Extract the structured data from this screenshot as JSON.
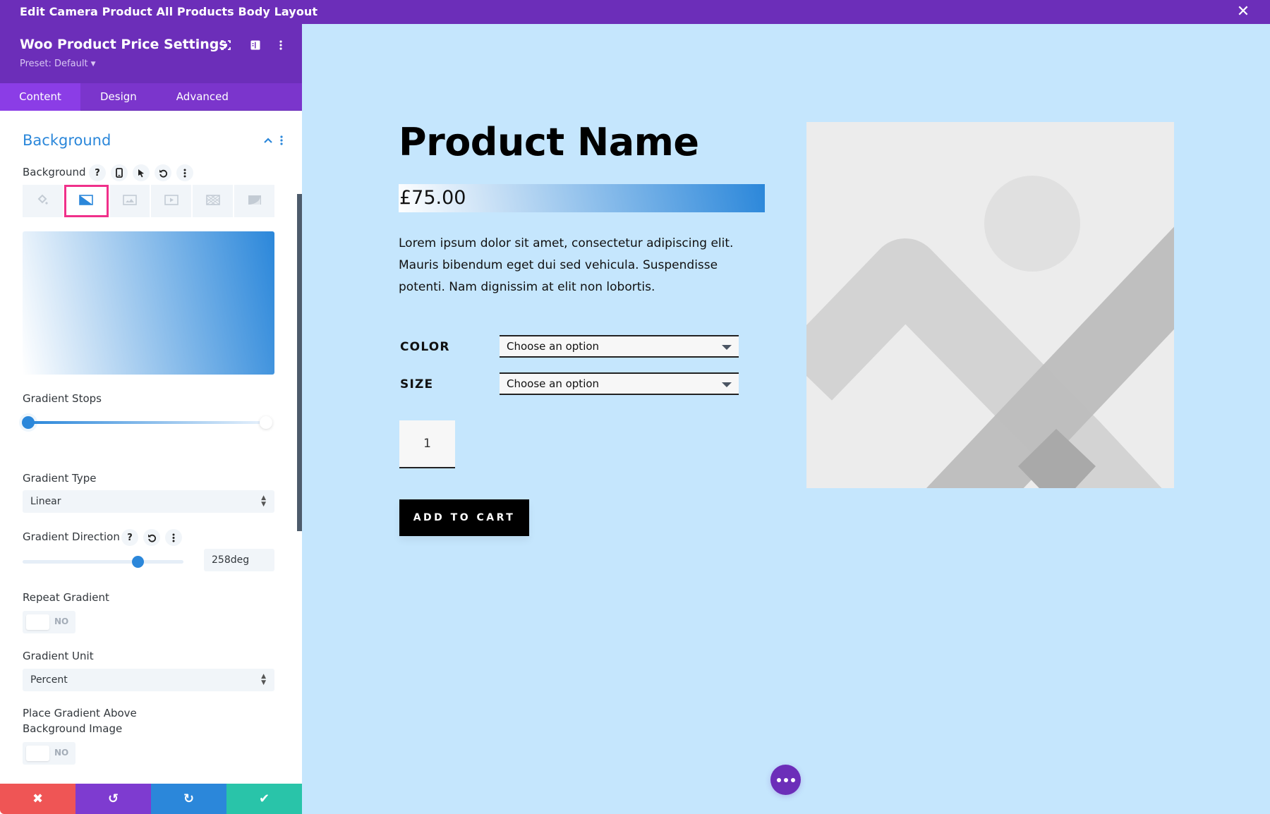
{
  "window": {
    "title": "Edit Camera Product All Products Body Layout",
    "close_icon": "close-icon"
  },
  "panel": {
    "title": "Woo Product Price Settings",
    "preset": "Preset: Default",
    "header_icons": [
      "focus-icon",
      "sidebar-layout-icon",
      "more-vertical-icon"
    ],
    "tabs": [
      {
        "label": "Content",
        "active": true
      },
      {
        "label": "Design",
        "active": false
      },
      {
        "label": "Advanced",
        "active": false
      }
    ],
    "section": {
      "title": "Background",
      "expanded": true
    },
    "background_field": {
      "label": "Background",
      "help": "?",
      "action_icons": [
        "help-icon",
        "responsive-phone-icon",
        "hover-cursor-icon",
        "reset-icon",
        "more-vertical-icon"
      ],
      "type_tabs": [
        {
          "name": "color",
          "icon": "paint-bucket-icon",
          "selected": false
        },
        {
          "name": "gradient",
          "icon": "gradient-icon",
          "selected": true
        },
        {
          "name": "image",
          "icon": "image-icon",
          "selected": false
        },
        {
          "name": "video",
          "icon": "video-icon",
          "selected": false
        },
        {
          "name": "pattern",
          "icon": "pattern-icon",
          "selected": false
        },
        {
          "name": "mask",
          "icon": "mask-icon",
          "selected": false
        }
      ]
    },
    "gradient": {
      "start_color": "#2B87DA",
      "end_color": "#FFFFFF",
      "stops_label": "Gradient Stops",
      "stops": [
        {
          "color": "#2B87DA",
          "position_percent": 0
        },
        {
          "color": "#FFFFFF",
          "position_percent": 100
        }
      ],
      "type_label": "Gradient Type",
      "type_value": "Linear",
      "direction_label": "Gradient Direction",
      "direction_value": "258deg",
      "direction_degrees": 258,
      "direction_max_degrees": 360,
      "repeat_label": "Repeat Gradient",
      "repeat_value": "NO",
      "unit_label": "Gradient Unit",
      "unit_value": "Percent",
      "place_above_label_line1": "Place Gradient Above",
      "place_above_label_line2": "Background Image",
      "place_above_value": "NO"
    },
    "footer": {
      "buttons": [
        {
          "name": "cancel",
          "icon": "close-icon",
          "glyph": "✖",
          "color": "#EF5555"
        },
        {
          "name": "undo",
          "icon": "undo-icon",
          "glyph": "↺",
          "color": "#7E3BD0"
        },
        {
          "name": "redo",
          "icon": "redo-icon",
          "glyph": "↻",
          "color": "#2B87DA"
        },
        {
          "name": "save",
          "icon": "check-icon",
          "glyph": "✔",
          "color": "#29C4A9"
        }
      ]
    }
  },
  "product": {
    "name": "Product Name",
    "price": "£75.00",
    "description": "Lorem ipsum dolor sit amet, consectetur adipiscing elit. Mauris bibendum eget dui sed vehicula. Suspendisse potenti. Nam dignissim at elit non lobortis.",
    "variations": [
      {
        "label": "COLOR",
        "value": "Choose an option"
      },
      {
        "label": "SIZE",
        "value": "Choose an option"
      }
    ],
    "quantity": "1",
    "add_to_cart": "ADD TO CART",
    "image": "placeholder-image-icon"
  },
  "colors": {
    "brand_purple": "#6C2EB9",
    "accent_blue": "#2B87DA",
    "canvas_bg": "#C5E6FD",
    "highlight_pink": "#F0308A"
  }
}
